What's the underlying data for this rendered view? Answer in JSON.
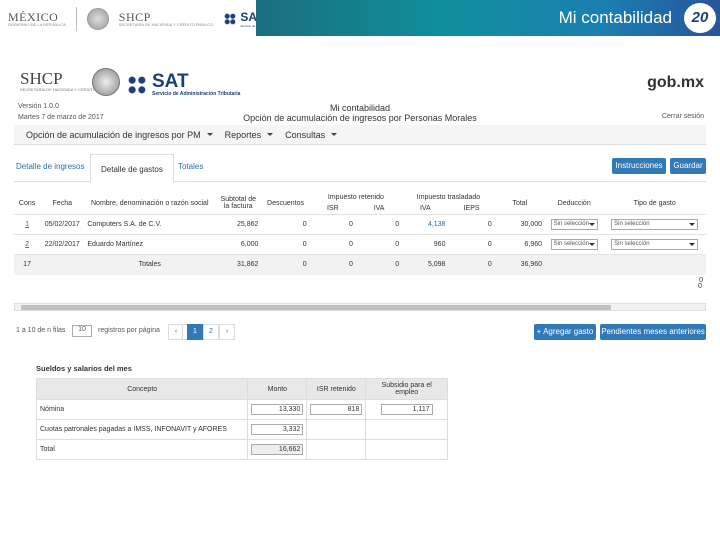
{
  "banner": {
    "mexico": "MÉXICO",
    "mexico_sub": "GOBIERNO DE LA REPÚBLICA",
    "shcp": "SHCP",
    "shcp_sub": "SECRETARÍA DE HACIENDA Y CRÉDITO PÚBLICO",
    "sat": "SAT",
    "sat_sub": "Servicio de Administración Tributaria",
    "title": "Mi contabilidad",
    "badge": "20"
  },
  "app_header": {
    "shcp": "SHCP",
    "shcp_sub": "SECRETARÍA DE HACIENDA Y CRÉDITO PÚBLICO",
    "sat": "SAT",
    "sat_sub": "Servicio de Administración Tributaria",
    "gobmx": "gob.mx",
    "version": "Versión 1.0.0",
    "fecha": "Martes 7 de marzo de 2017",
    "app_title": "Mi contabilidad",
    "app_subtitle": "Opción de acumulación de ingresos por Personas Morales",
    "logout": "Cerrar sesión"
  },
  "menu": [
    {
      "label": "Opción de acumulación de ingresos por PM"
    },
    {
      "label": "Reportes"
    },
    {
      "label": "Consultas"
    }
  ],
  "tabs": [
    {
      "label": "Detalle de ingresos"
    },
    {
      "label": "Detalle de gastos"
    },
    {
      "label": "Totales"
    }
  ],
  "buttons": {
    "instrucciones": "Instrucciones",
    "guardar": "Guardar",
    "agregar": "+ Agregar gasto",
    "pendientes": "Pendientes meses anteriores"
  },
  "table": {
    "headers": {
      "cons": "Cons",
      "fecha": "Fecha",
      "nombre": "Nombre, denominación o razón social",
      "subtotal": "Subtotal de la factura",
      "descuentos": "Descuentos",
      "imp_retenido": "Impuesto retenido",
      "imp_trasladado": "Impuesto trasladado",
      "isr": "ISR",
      "iva": "IVA",
      "iva2": "IVA",
      "ieps": "IEPS",
      "total": "Total",
      "deduccion": "Deducción",
      "tipo_gasto": "Tipo de gasto"
    },
    "rows": [
      {
        "cons": "1",
        "fecha": "05/02/2017",
        "nombre": "Computers S.A. de C.V.",
        "subtotal": "25,862",
        "descuentos": "0",
        "isr": "0",
        "iva": "0",
        "iva2": "4,138",
        "ieps": "0",
        "total": "30,000",
        "deduccion": "Sin selección",
        "tipo": "Sin selección"
      },
      {
        "cons": "2",
        "fecha": "22/02/2017",
        "nombre": "Eduardo Martínez",
        "subtotal": "6,000",
        "descuentos": "0",
        "isr": "0",
        "iva": "0",
        "iva2": "960",
        "ieps": "0",
        "total": "6,960",
        "deduccion": "Sin selección",
        "tipo": "Sin selección"
      }
    ],
    "totals": {
      "cons": "17",
      "label": "Totales",
      "subtotal": "31,862",
      "descuentos": "0",
      "isr": "0",
      "iva": "0",
      "iva2": "5,098",
      "ieps": "0",
      "total": "36,960"
    },
    "extra_rows": [
      "0",
      "0"
    ]
  },
  "pager": {
    "info_prefix": "1 a 10 de n filas",
    "page_size": "10",
    "info_suffix": "registros por página",
    "prev": "‹",
    "first_prev": "‹",
    "page1": "1",
    "page2": "2",
    "next": "›"
  },
  "sueldos": {
    "title": "Sueldos y salarios del mes",
    "headers": {
      "concepto": "Concepto",
      "monto": "Monto",
      "isr": "ISR retenido",
      "subsidio": "Subsidio para el empleo"
    },
    "rows": [
      {
        "concepto": "Nómina",
        "monto": "13,330",
        "isr": "818",
        "subsidio": "1,117"
      },
      {
        "concepto": "Cuotas patronales pagadas a IMSS, INFONAVIT y AFORES",
        "monto": "3,332",
        "isr": "",
        "subsidio": ""
      },
      {
        "concepto": "Total",
        "monto": "16,662",
        "isr": "",
        "subsidio": ""
      }
    ]
  },
  "colors": {
    "accent": "#3279b7",
    "banner_start": "#1b6e7e",
    "banner_end": "#27559a"
  }
}
